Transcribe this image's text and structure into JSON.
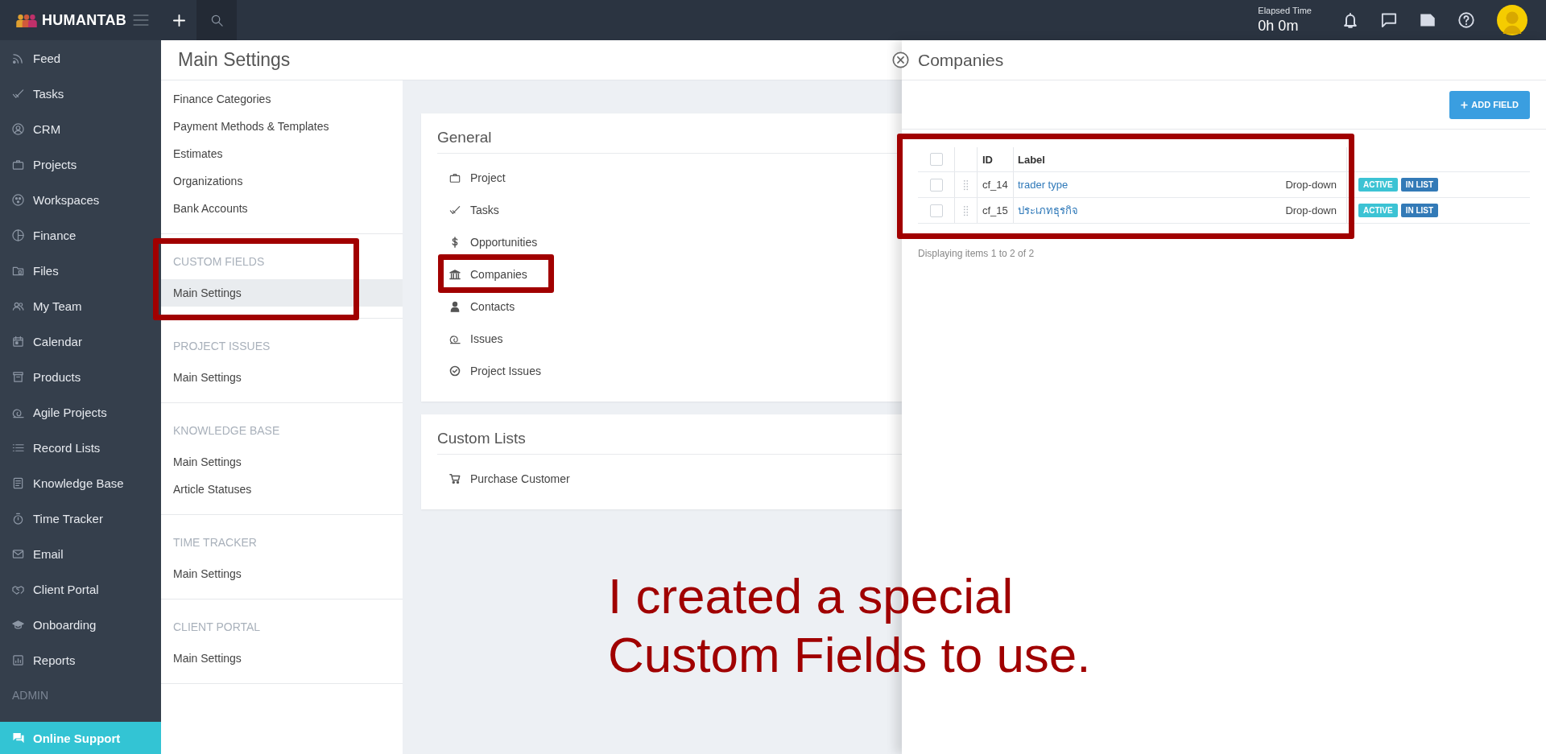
{
  "topbar": {
    "logo": "HUMANTAB",
    "elapsed_label": "Elapsed Time",
    "elapsed_value": "0h 0m"
  },
  "sidebar": {
    "items": [
      {
        "label": "Feed"
      },
      {
        "label": "Tasks"
      },
      {
        "label": "CRM"
      },
      {
        "label": "Projects"
      },
      {
        "label": "Workspaces"
      },
      {
        "label": "Finance"
      },
      {
        "label": "Files"
      },
      {
        "label": "My Team"
      },
      {
        "label": "Calendar"
      },
      {
        "label": "Products"
      },
      {
        "label": "Agile Projects"
      },
      {
        "label": "Record Lists"
      },
      {
        "label": "Knowledge Base"
      },
      {
        "label": "Time Tracker"
      },
      {
        "label": "Email"
      },
      {
        "label": "Client Portal"
      },
      {
        "label": "Onboarding"
      },
      {
        "label": "Reports"
      }
    ],
    "section": "ADMIN",
    "support": "Online Support"
  },
  "page_title": "Main Settings",
  "settings_nav": {
    "groups": [
      {
        "items": [
          {
            "label": "Finance Categories",
            "selected": false
          },
          {
            "label": "Payment Methods & Templates",
            "selected": false
          },
          {
            "label": "Estimates",
            "selected": false
          },
          {
            "label": "Organizations",
            "selected": false
          },
          {
            "label": "Bank Accounts",
            "selected": false
          }
        ]
      },
      {
        "title": "CUSTOM FIELDS",
        "items": [
          {
            "label": "Main Settings",
            "selected": true
          }
        ]
      },
      {
        "title": "PROJECT ISSUES",
        "items": [
          {
            "label": "Main Settings",
            "selected": false
          }
        ]
      },
      {
        "title": "KNOWLEDGE BASE",
        "items": [
          {
            "label": "Main Settings",
            "selected": false
          },
          {
            "label": "Article Statuses",
            "selected": false
          }
        ]
      },
      {
        "title": "TIME TRACKER",
        "items": [
          {
            "label": "Main Settings",
            "selected": false
          }
        ]
      },
      {
        "title": "CLIENT PORTAL",
        "items": [
          {
            "label": "Main Settings",
            "selected": false
          }
        ]
      }
    ]
  },
  "cards": [
    {
      "title": "General",
      "items": [
        {
          "label": "Project"
        },
        {
          "label": "Tasks"
        },
        {
          "label": "Opportunities"
        },
        {
          "label": "Companies"
        },
        {
          "label": "Contacts"
        },
        {
          "label": "Issues"
        },
        {
          "label": "Project Issues"
        }
      ]
    },
    {
      "title": "Custom Lists",
      "items": [
        {
          "label": "Purchase Customer"
        }
      ]
    }
  ],
  "panel": {
    "title": "Companies",
    "add_button": "ADD FIELD",
    "table": {
      "columns": [
        "ID",
        "Label"
      ],
      "header_checked": false,
      "rows": [
        {
          "checked": false,
          "id": "cf_14",
          "label": "trader type",
          "type": "Drop-down",
          "badges": [
            {
              "text": "ACTIVE",
              "color": "#3cc3d4"
            },
            {
              "text": "IN LIST",
              "color": "#337ab7"
            }
          ]
        },
        {
          "checked": false,
          "id": "cf_15",
          "label": "ประเภทธุรกิจ",
          "type": "Drop-down",
          "badges": [
            {
              "text": "ACTIVE",
              "color": "#3cc3d4"
            },
            {
              "text": "IN LIST",
              "color": "#337ab7"
            }
          ]
        }
      ]
    },
    "footer": "Displaying items 1 to 2 of 2"
  },
  "annotation": "I created a special Custom Fields to use."
}
